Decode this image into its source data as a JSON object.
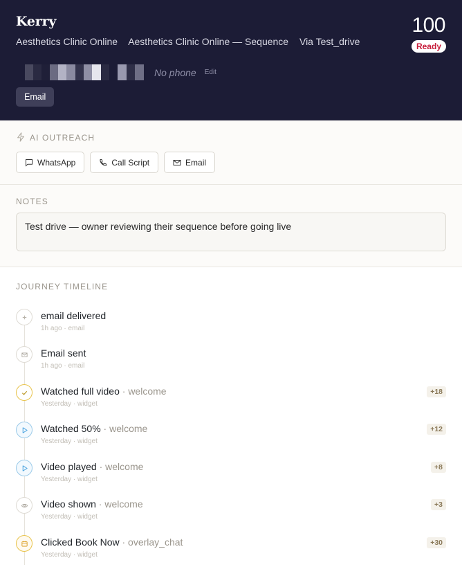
{
  "lead": {
    "name": "Kerry",
    "segments": [
      "Aesthetics Clinic Online",
      "Aesthetics Clinic Online — Sequence",
      "Via Test_drive"
    ],
    "score": "100",
    "status": "Ready",
    "phone_placeholder": "No phone",
    "edit_label": "Edit",
    "channel": "Email"
  },
  "ai_outreach": {
    "title": "AI OUTREACH",
    "buttons": [
      {
        "label": "WhatsApp",
        "icon": "message-icon"
      },
      {
        "label": "Call Script",
        "icon": "phone-icon"
      },
      {
        "label": "Email",
        "icon": "mail-icon"
      }
    ]
  },
  "notes": {
    "title": "NOTES",
    "text": "Test drive — owner reviewing their sequence before going live"
  },
  "journey": {
    "title": "JOURNEY TIMELINE",
    "events": [
      {
        "title": "email delivered",
        "context": "",
        "meta": "1h ago · email",
        "points": "",
        "icon": "plus-icon"
      },
      {
        "title": "Email sent",
        "context": "",
        "meta": "1h ago · email",
        "points": "",
        "icon": "mail-icon"
      },
      {
        "title": "Watched full video",
        "context": " · welcome",
        "meta": "Yesterday · widget",
        "points": "+18",
        "icon": "check-icon"
      },
      {
        "title": "Watched 50%",
        "context": " · welcome",
        "meta": "Yesterday · widget",
        "points": "+12",
        "icon": "play-icon"
      },
      {
        "title": "Video played",
        "context": " · welcome",
        "meta": "Yesterday · widget",
        "points": "+8",
        "icon": "play-icon"
      },
      {
        "title": "Video shown",
        "context": " · welcome",
        "meta": "Yesterday · widget",
        "points": "+3",
        "icon": "eye-icon"
      },
      {
        "title": "Clicked Book Now",
        "context": " · overlay_chat",
        "meta": "Yesterday · widget",
        "points": "+30",
        "icon": "calendar-icon"
      }
    ]
  },
  "colors": {
    "header_bg": "#1c1c36",
    "status_text": "#c81e3c",
    "check_accent": "#e8c34a",
    "play_accent": "#4aa3df"
  }
}
